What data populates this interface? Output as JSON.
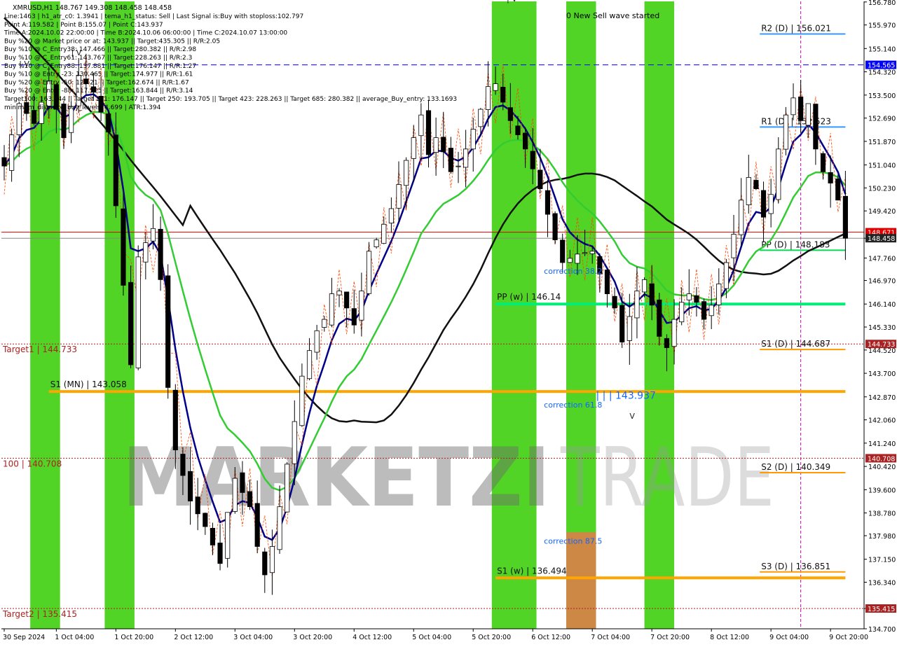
{
  "header": {
    "symbol_line": "XMRUSD,H1  148.767 149.308 148.458 148.458",
    "info_lines": [
      "Line:1463 | h1_atr_c0: 1.3941 | tema_h1_status: Sell | Last Signal is:Buy with stoploss:102.797",
      "Point A:119.582 | Point B:155.07 | Point C:143.937",
      "Time A:2024.10.02 22:00:00 | Time B:2024.10.06 06:00:00 | Time C:2024.10.07 13:00:00",
      "Buy %20 @ Market price or at: 143.937 || Target:435.305 || R/R:2.05",
      "Buy %10 @ C_Entry38: 147.466 || Target:280.382 || R/R:2.98",
      "Buy %10 @ C_Entry61: 143.767 || Target:228.263 || R/R:2.3",
      "Buy %10 @ C_Entry88: 137.881 || Target:176.147 || R/R:1.27",
      "Buy %10 @ Entry -23: 130.465 || Target:174.977 || R/R:1.61",
      "Buy %20 @ Entry -50: 125.21 || Target:162.674 || R/R:1.67",
      "Buy %20 @ Entry -88: 117.525 || Target:163.844 || R/R:3.14",
      "Target100: 163.844 || Target 161: 176.147 || Target 250: 193.705 || Target 423: 228.263 || Target 685: 280.382 || average_Buy_entry: 133.1693",
      "minimum_distance_buy_levels: 4.699 | ATR:1.394"
    ],
    "signal_text": "0 New Sell wave started"
  },
  "watermark": {
    "left": "MARKETZI",
    "right": "TRADE"
  },
  "chart_data": {
    "type": "candlestick",
    "symbol": "XMRUSD",
    "timeframe": "H1",
    "ohlc_last": {
      "open": 148.767,
      "high": 149.308,
      "low": 148.458,
      "close": 148.458
    },
    "ylim": [
      134.7,
      156.8
    ],
    "y_ticks": [
      156.78,
      155.97,
      155.14,
      154.32,
      153.5,
      152.69,
      151.87,
      151.04,
      150.23,
      149.42,
      148.458,
      147.76,
      146.97,
      146.14,
      145.33,
      144.52,
      143.7,
      142.87,
      142.06,
      141.24,
      140.42,
      139.6,
      138.78,
      137.98,
      137.15,
      136.34,
      135.415,
      134.7
    ],
    "y_tick_labels": [
      "156.780",
      "155.970",
      "155.140",
      "154.320",
      "153.500",
      "152.690",
      "151.870",
      "151.040",
      "150.230",
      "149.420",
      "148.458",
      "147.760",
      "146.970",
      "146.140",
      "145.330",
      "144.520",
      "143.700",
      "142.870",
      "142.060",
      "141.240",
      "140.420",
      "139.600",
      "138.780",
      "137.980",
      "137.150",
      "136.340",
      "135.415",
      "134.700"
    ],
    "x_labels": [
      "30 Sep 2024",
      "1 Oct 04:00",
      "1 Oct 20:00",
      "2 Oct 12:00",
      "3 Oct 04:00",
      "3 Oct 20:00",
      "4 Oct 12:00",
      "5 Oct 04:00",
      "5 Oct 20:00",
      "6 Oct 12:00",
      "7 Oct 04:00",
      "7 Oct 20:00",
      "8 Oct 12:00",
      "9 Oct 04:00",
      "9 Oct 20:00"
    ],
    "x_label_index": [
      0,
      7,
      15,
      23,
      31,
      39,
      47,
      55,
      63,
      71,
      79,
      87,
      95,
      103,
      111
    ],
    "n_bars": 114,
    "close_path": [
      [
        0,
        151.0
      ],
      [
        2,
        153.2
      ],
      [
        4,
        152.5
      ],
      [
        6,
        154.0
      ],
      [
        8,
        152.0
      ],
      [
        10,
        154.2
      ],
      [
        12,
        153.6
      ],
      [
        14,
        152.2
      ],
      [
        15,
        149.6
      ],
      [
        16,
        146.8
      ],
      [
        17,
        144.0
      ],
      [
        18,
        147.8
      ],
      [
        20,
        148.8
      ],
      [
        21,
        147.0
      ],
      [
        22,
        143.2
      ],
      [
        23,
        141.0
      ],
      [
        25,
        139.2
      ],
      [
        27,
        138.3
      ],
      [
        29,
        137.0
      ],
      [
        30,
        138.8
      ],
      [
        31,
        140.0
      ],
      [
        33,
        139.0
      ],
      [
        34,
        137.6
      ],
      [
        35,
        136.6
      ],
      [
        36,
        137.6
      ],
      [
        37,
        139.0
      ],
      [
        38,
        140.5
      ],
      [
        39,
        142.0
      ],
      [
        40,
        143.6
      ],
      [
        41,
        144.5
      ],
      [
        42,
        145.2
      ],
      [
        43,
        145.6
      ],
      [
        44,
        146.5
      ],
      [
        45,
        146.6
      ],
      [
        46,
        146.0
      ],
      [
        47,
        145.4
      ],
      [
        48,
        146.6
      ],
      [
        49,
        148.0
      ],
      [
        50,
        148.4
      ],
      [
        52,
        149.5
      ],
      [
        54,
        151.2
      ],
      [
        56,
        152.8
      ],
      [
        57,
        151.4
      ],
      [
        58,
        152.0
      ],
      [
        59,
        151.5
      ],
      [
        60,
        150.8
      ],
      [
        61,
        151.0
      ],
      [
        62,
        151.6
      ],
      [
        64,
        153.0
      ],
      [
        65,
        153.8
      ],
      [
        66,
        153.9
      ],
      [
        68,
        152.6
      ],
      [
        70,
        151.6
      ],
      [
        72,
        150.2
      ],
      [
        73,
        149.3
      ],
      [
        74,
        148.4
      ],
      [
        75,
        147.6
      ],
      [
        77,
        147.9
      ],
      [
        79,
        148.0
      ],
      [
        80,
        147.2
      ],
      [
        81,
        146.5
      ],
      [
        82,
        146.0
      ],
      [
        83,
        144.8
      ],
      [
        84,
        145.7
      ],
      [
        85,
        146.6
      ],
      [
        86,
        147.0
      ],
      [
        87,
        146.1
      ],
      [
        88,
        145.0
      ],
      [
        89,
        144.6
      ],
      [
        90,
        145.6
      ],
      [
        91,
        146.2
      ],
      [
        92,
        146.5
      ],
      [
        93,
        146.2
      ],
      [
        94,
        145.6
      ],
      [
        95,
        146.1
      ],
      [
        97,
        147.6
      ],
      [
        98,
        148.6
      ],
      [
        99,
        149.8
      ],
      [
        100,
        150.6
      ],
      [
        101,
        150.2
      ],
      [
        102,
        149.2
      ],
      [
        103,
        150.0
      ],
      [
        104,
        151.6
      ],
      [
        105,
        152.8
      ],
      [
        106,
        153.4
      ],
      [
        107,
        152.6
      ],
      [
        108,
        153.2
      ],
      [
        109,
        151.6
      ],
      [
        110,
        150.8
      ],
      [
        111,
        150.4
      ],
      [
        112,
        149.8
      ],
      [
        113,
        148.458
      ]
    ],
    "bands": [
      {
        "from": 3.5,
        "to": 7.5,
        "color": "#33cc00"
      },
      {
        "from": 13.5,
        "to": 17.5,
        "color": "#33cc00"
      },
      {
        "from": 65.5,
        "to": 71.5,
        "color": "#33cc00"
      },
      {
        "from": 75.5,
        "to": 79.5,
        "color": "#33cc00"
      },
      {
        "from": 86.0,
        "to": 90.0,
        "color": "#33cc00"
      }
    ],
    "orange_block": {
      "from": 75.5,
      "to": 79.5,
      "top": 138.1,
      "bottom": 134.7,
      "color": "#cc8844"
    },
    "levels": [
      {
        "label": "R2 (D) | 156.021",
        "value": 155.8,
        "from": 101.5,
        "to": 113,
        "color": "#3399ff",
        "thick": false
      },
      {
        "label": "R1 (D) | 152.523",
        "value": 152.523,
        "from": 101.5,
        "to": 113,
        "color": "#3399ff",
        "thick": false
      },
      {
        "label": "PP (D) | 148.183",
        "value": 148.183,
        "from": 101.5,
        "to": 113,
        "color": "#00dd55",
        "thick": false
      },
      {
        "label": "PP (w) | 146.14",
        "value": 146.14,
        "from": 66,
        "to": 113,
        "color": "#00ee77",
        "thick": true
      },
      {
        "label": "S1 (D) | 144.687",
        "value": 144.687,
        "from": 101.5,
        "to": 113,
        "color": "#ff9900",
        "thick": false
      },
      {
        "label": "S1 (MN) | 143.058",
        "value": 143.058,
        "from": 6,
        "to": 113,
        "color": "#ffa500",
        "thick": true
      },
      {
        "label": "S2 (D) | 140.349",
        "value": 140.349,
        "from": 101.5,
        "to": 113,
        "color": "#ff9900",
        "thick": false
      },
      {
        "label": "S3 (D) | 136.851",
        "value": 136.851,
        "from": 101.5,
        "to": 113,
        "color": "#ff9900",
        "thick": false
      },
      {
        "label": "S1 (w) | 136.494",
        "value": 136.494,
        "from": 66,
        "to": 113,
        "color": "#ffa500",
        "thick": true
      }
    ],
    "hlines": [
      {
        "label": "Target1 | 144.733",
        "value": 144.733,
        "color": "#aa2222",
        "dash": true
      },
      {
        "label": "100 | 140.708",
        "value": 140.708,
        "color": "#aa2222",
        "dash": true
      },
      {
        "label": "Target2 | 135.415",
        "value": 135.415,
        "color": "#aa2222",
        "dash": true
      },
      {
        "label": "",
        "value": 154.565,
        "color": "#0000ff",
        "dash": true
      },
      {
        "label": "",
        "value": 148.671,
        "color": "#dd0000",
        "dash": false
      },
      {
        "label": "",
        "value": 148.458,
        "color": "#888888",
        "dash": false
      }
    ],
    "price_badges": [
      {
        "text": "154.565",
        "value": 154.565,
        "bg": "#0000ff"
      },
      {
        "text": "148.671",
        "value": 148.671,
        "bg": "#dd0000"
      },
      {
        "text": "148.458",
        "value": 148.458,
        "bg": "#222222"
      },
      {
        "text": "144.733",
        "value": 144.733,
        "bg": "#aa2222"
      },
      {
        "text": "140.708",
        "value": 140.708,
        "bg": "#aa2222"
      },
      {
        "text": "135.415",
        "value": 135.415,
        "bg": "#aa2222"
      }
    ],
    "annotations": [
      {
        "text": "correction 38.2",
        "x": 72.5,
        "y": 147.2,
        "color": "#1166ff"
      },
      {
        "text": "correction 61.8",
        "x": 72.5,
        "y": 142.5,
        "color": "#1166ff"
      },
      {
        "text": "correction 87.5",
        "x": 72.5,
        "y": 137.7,
        "color": "#1166ff"
      },
      {
        "text": "| | | 143.937",
        "x": 79.5,
        "y": 142.8,
        "color": "#1166ff"
      },
      {
        "text": "V",
        "x": 84.0,
        "y": 142.1,
        "color": "#222222"
      },
      {
        "text": "| V",
        "x": 67.5,
        "y": 156.8,
        "color": "#222222"
      },
      {
        "text": "| V",
        "x": 2.0,
        "y": 154.5,
        "color": "#222222"
      },
      {
        "text": "| V",
        "x": 9.0,
        "y": 154.9,
        "color": "#222222"
      }
    ],
    "vline_time_index": 107,
    "legend": "none",
    "grid": false
  }
}
